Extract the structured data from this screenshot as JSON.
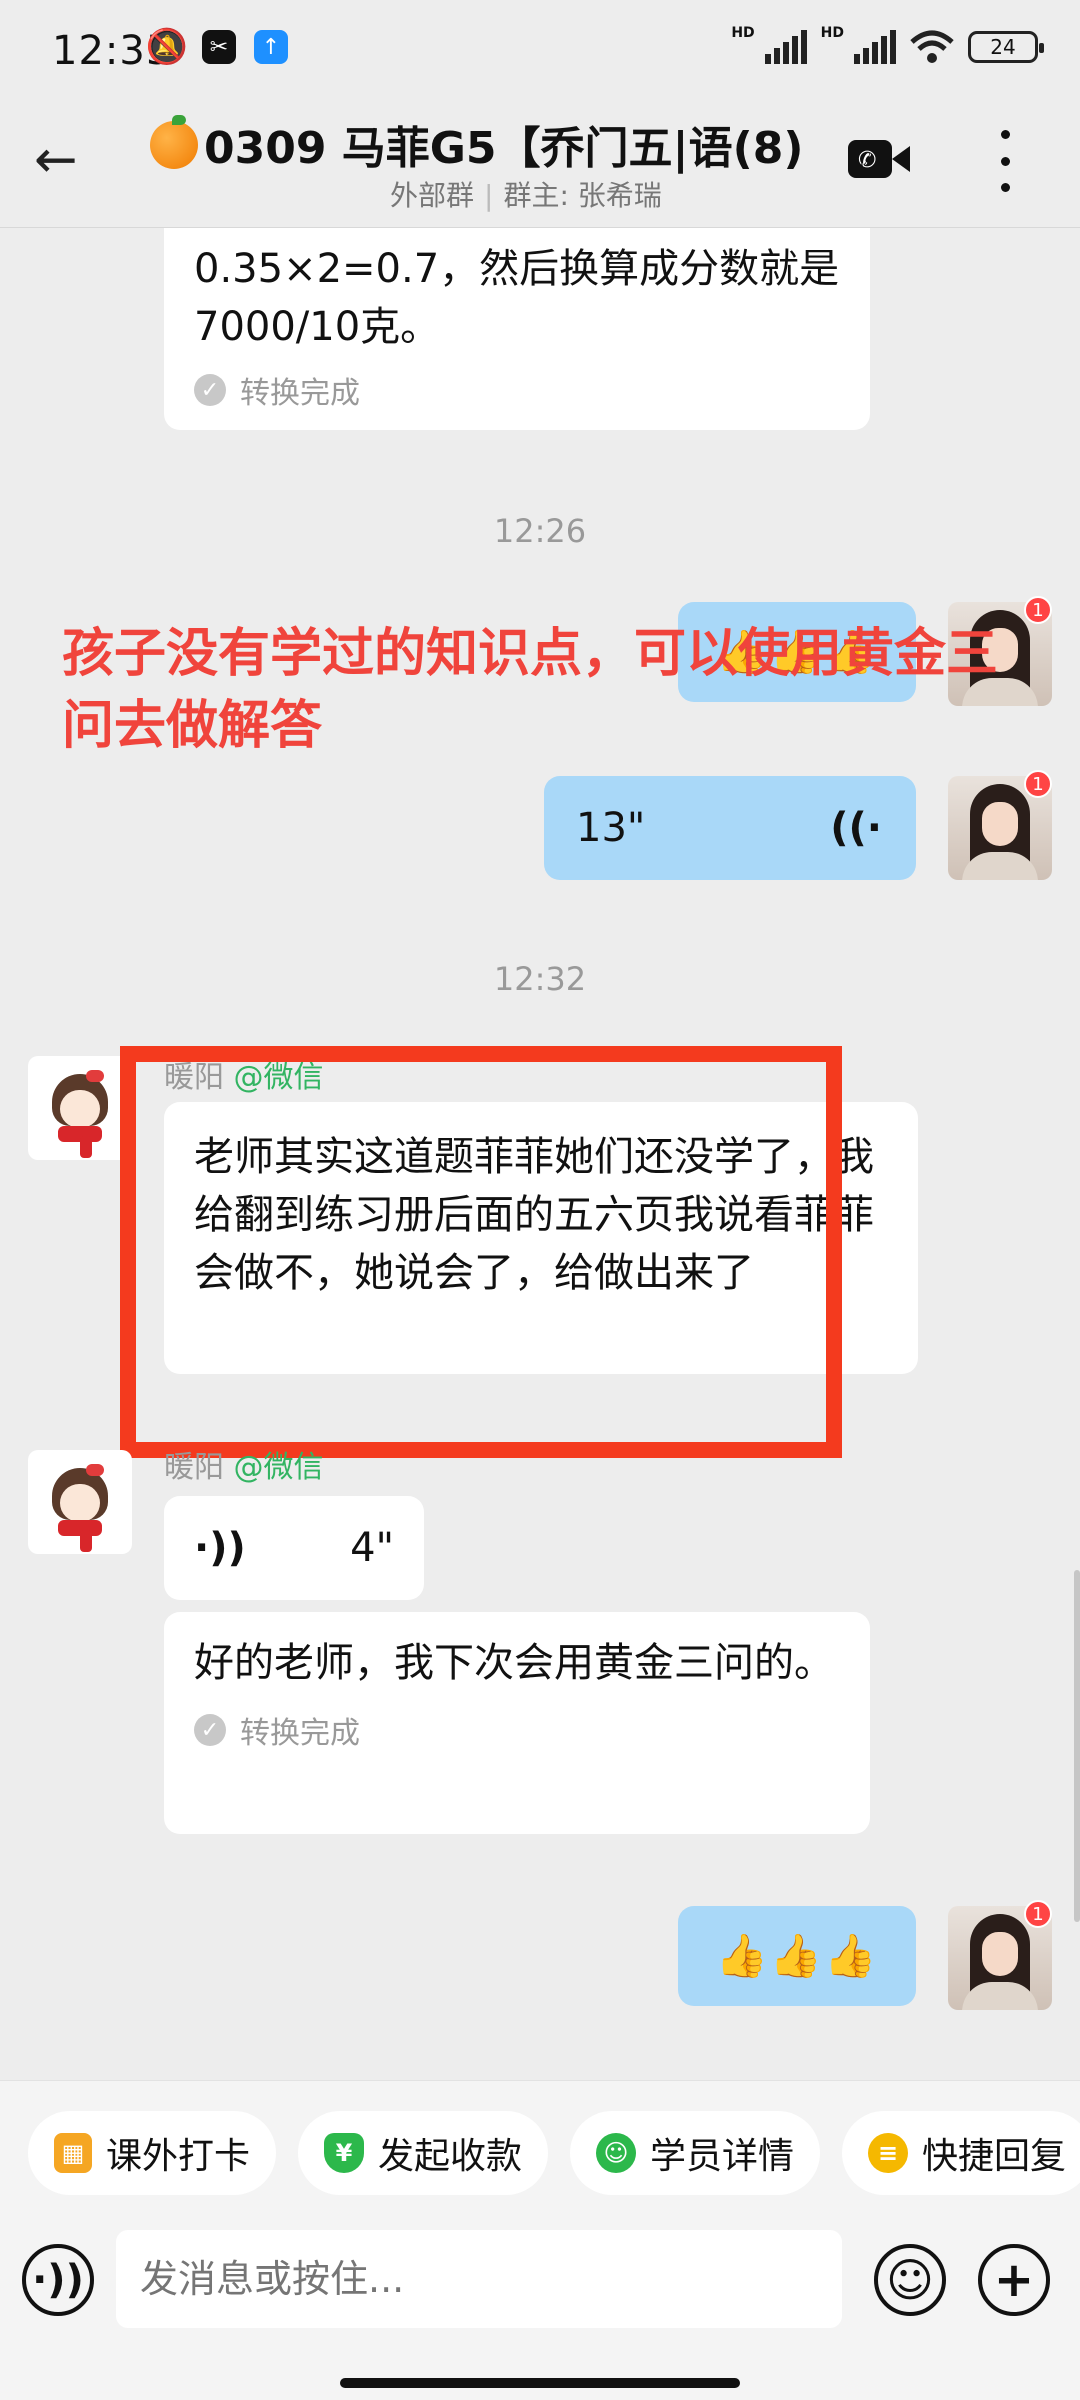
{
  "status_bar": {
    "time": "12:35",
    "battery": "24"
  },
  "header": {
    "title": "0309 马菲G5【乔门五|语",
    "count": "(8)",
    "group_type": "外部群",
    "owner": "群主: 张希瑞"
  },
  "messages": {
    "m1_text": "0.35×2=0.7，然后换算成分数就是7000/10克。",
    "m1_status": "转换完成",
    "time_1": "12:26",
    "m2_thumbs": "👍👍👍",
    "m3_duration": "13\"",
    "time_2": "12:32",
    "sender_name": "暖阳",
    "sender_src": "@微信",
    "m4_text": "老师其实这道题菲菲她们还没学了，我给翻到练习册后面的五六页我说看菲菲会做不，她说会了，给做出来了",
    "m5_duration": "4\"",
    "m6_text": "好的老师，我下次会用黄金三问的。",
    "m6_status": "转换完成",
    "m7_thumbs": "👍👍👍",
    "badge": "1"
  },
  "annotation": "孩子没有学过的知识点，可以使用黄金三问去做解答",
  "quick_actions": [
    {
      "label": "课外打卡",
      "icon": "calendar-icon",
      "color": "#f5a623"
    },
    {
      "label": "发起收款",
      "icon": "yen-shield-icon",
      "color": "#2cb84b"
    },
    {
      "label": "学员详情",
      "icon": "student-icon",
      "color": "#2cb84b"
    },
    {
      "label": "快捷回复",
      "icon": "quick-reply-icon",
      "color": "#f5b800"
    }
  ],
  "input": {
    "placeholder": "发消息或按住..."
  }
}
